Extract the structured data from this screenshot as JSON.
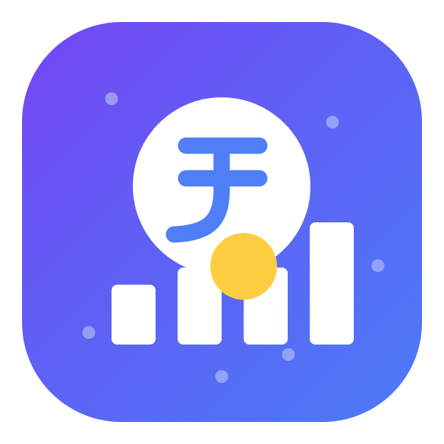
{
  "app_icon": {
    "name": "rupee-growth-app-icon",
    "symbol": "rupee-sign",
    "colors": {
      "background_start": "#7446f4",
      "background_end": "#4a7bf6",
      "bars": "#ffffff",
      "coin_badge": "#ffffff",
      "rupee_symbol": "#4f7ef6",
      "accent_coin": "#ffcd41",
      "sparkle": "#a7b3fa"
    },
    "bar_levels": [
      0.49,
      0.63,
      0.63,
      1.0
    ]
  }
}
